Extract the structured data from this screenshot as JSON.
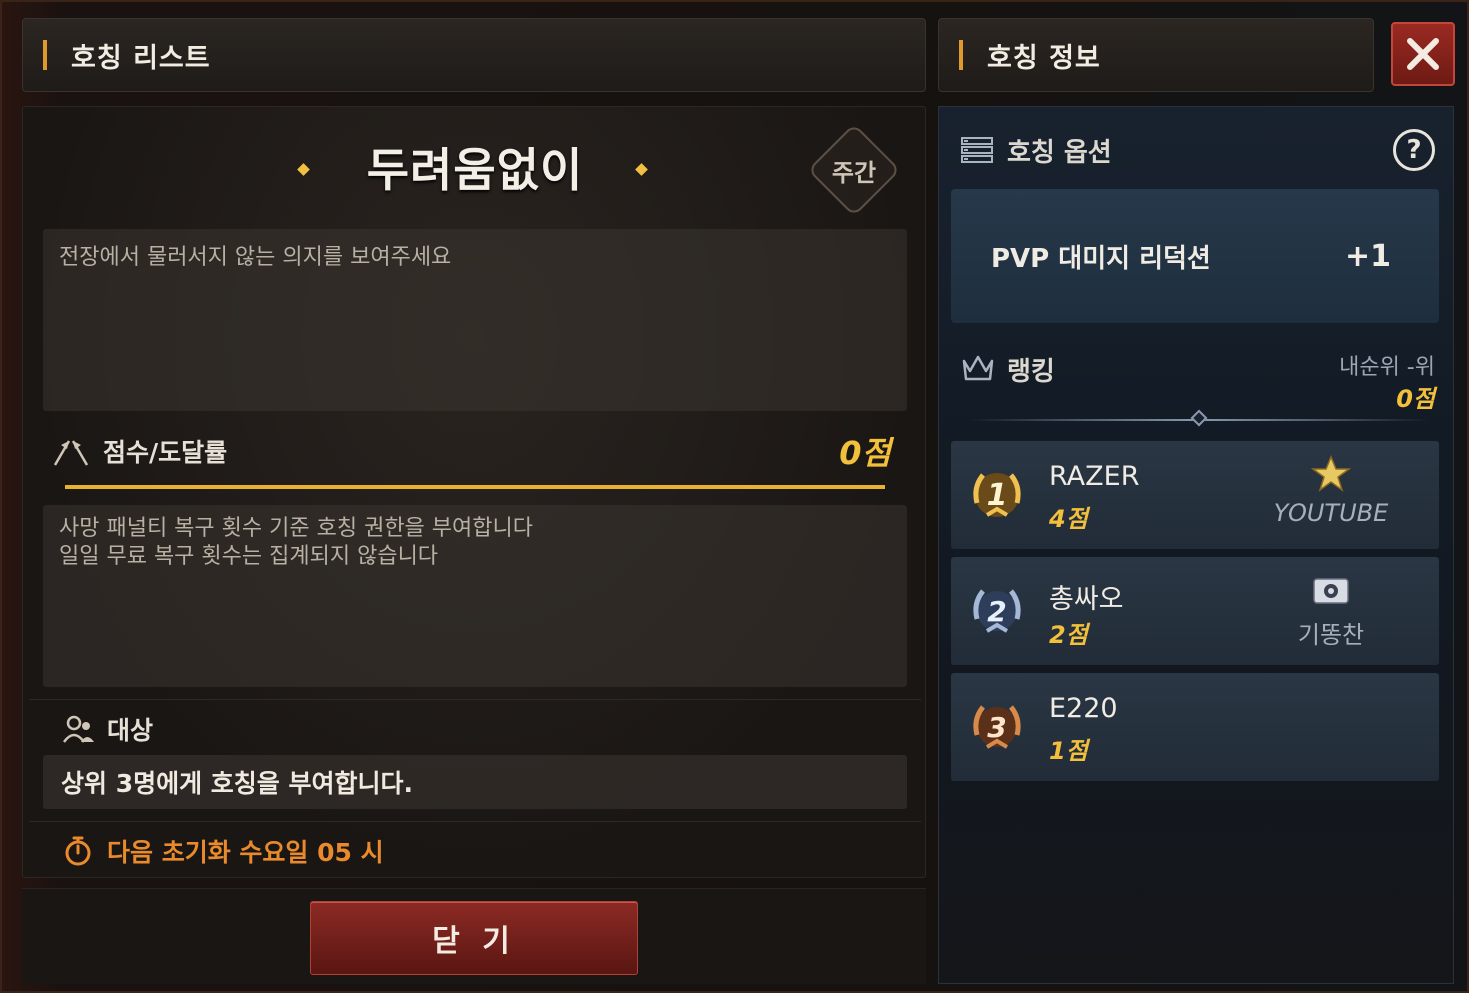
{
  "left_header": {
    "title": "호칭 리스트"
  },
  "right_header": {
    "title": "호칭 정보"
  },
  "title_card": {
    "name": "두려움없이",
    "period_badge": "주간",
    "description": "전장에서 물러서지 않는 의지를 보여주세요"
  },
  "score": {
    "label": "점수/도달률",
    "value": "0점",
    "progress": 1.0
  },
  "condition": {
    "line1": "사망 패널티 복구 횟수 기준 호칭 권한을 부여합니다",
    "line2": "일일 무료 복구 횟수는 집계되지 않습니다"
  },
  "target": {
    "label": "대상",
    "text": "상위 3명에게 호칭을 부여합니다."
  },
  "reset": {
    "text": "다음 초기화 수요일 05 시"
  },
  "close_button": {
    "label": "닫 기"
  },
  "options": {
    "label": "호칭 옵션",
    "help": "?",
    "option_name": "PVP 대미지 리덕션",
    "option_value": "+1"
  },
  "ranking": {
    "label": "랭킹",
    "my_rank": "내순위 -위",
    "my_points": "0점",
    "entries": [
      {
        "rank": "1",
        "name": "RAZER",
        "points": "4점",
        "guild": "YOUTUBE",
        "guild_icon": "star-emblem-icon"
      },
      {
        "rank": "2",
        "name": "총싸오",
        "points": "2점",
        "guild": "기똥찬",
        "guild_icon": "camera-emblem-icon"
      },
      {
        "rank": "3",
        "name": "E220",
        "points": "1점",
        "guild": "",
        "guild_icon": ""
      }
    ]
  },
  "colors": {
    "accent_gold": "#f3c03c",
    "accent_orange": "#e98a2c",
    "button_red": "#8c2a24"
  }
}
